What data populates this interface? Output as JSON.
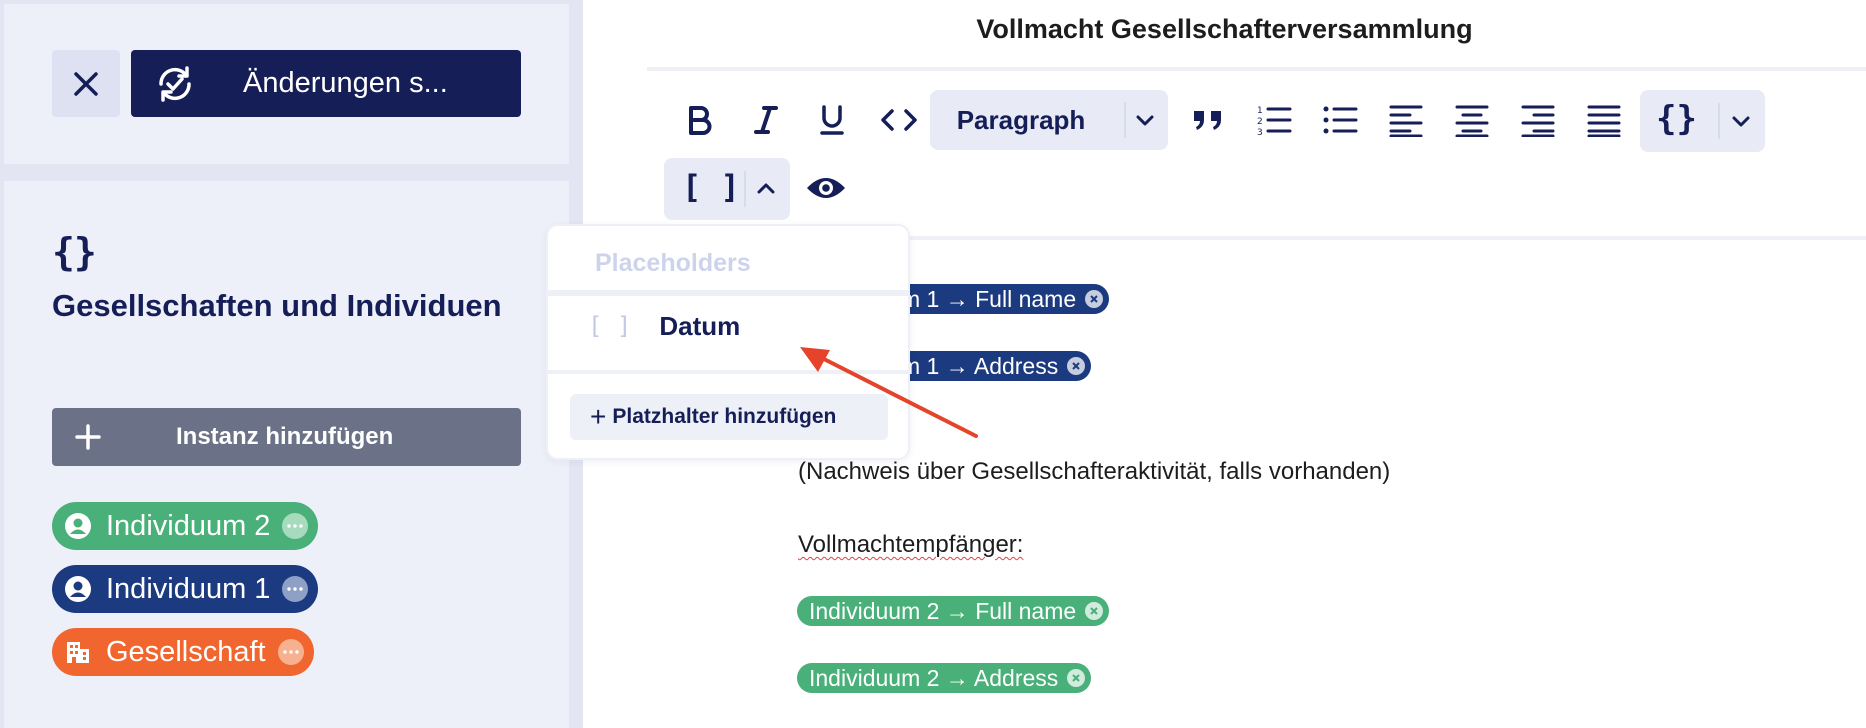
{
  "sidebar": {
    "save_label": "Änderungen s...",
    "group_title": "Gesellschaften und Individuen",
    "add_instance_label": "Instanz hinzufügen",
    "instances": [
      {
        "label": "Individuum 2",
        "color": "#49b07a",
        "icon": "person-icon"
      },
      {
        "label": "Individuum 1",
        "color": "#1c3a7f",
        "icon": "person-icon"
      },
      {
        "label": "Gesellschaft",
        "color": "#f0662e",
        "icon": "building-icon"
      }
    ]
  },
  "editor": {
    "title": "Vollmacht Gesellschafterversammlung",
    "toolbar": {
      "paragraph_select": "Paragraph",
      "code_label": "<>",
      "placeholder_brackets": "[ ]",
      "variables_braces": "{}"
    },
    "content": {
      "pill1": "m 1 → Full name",
      "pill2": "m 1 → Address",
      "note": "(Nachweis über Gesellschafteraktivität, falls vorhanden)",
      "recipient_label": "Vollmachtempfänger:",
      "pill3": "Individuum 2 → Full name",
      "pill4": "Individuum 2 → Address"
    }
  },
  "popover": {
    "header": "Placeholders",
    "items": [
      {
        "icon": "[ ]",
        "label": "Datum"
      }
    ],
    "add_label": "Platzhalter hinzufügen"
  },
  "colors": {
    "navy": "#151e57",
    "green": "#49b07a",
    "blue": "#1c3a7f",
    "orange": "#f0662e",
    "arrow": "#e5432a"
  }
}
